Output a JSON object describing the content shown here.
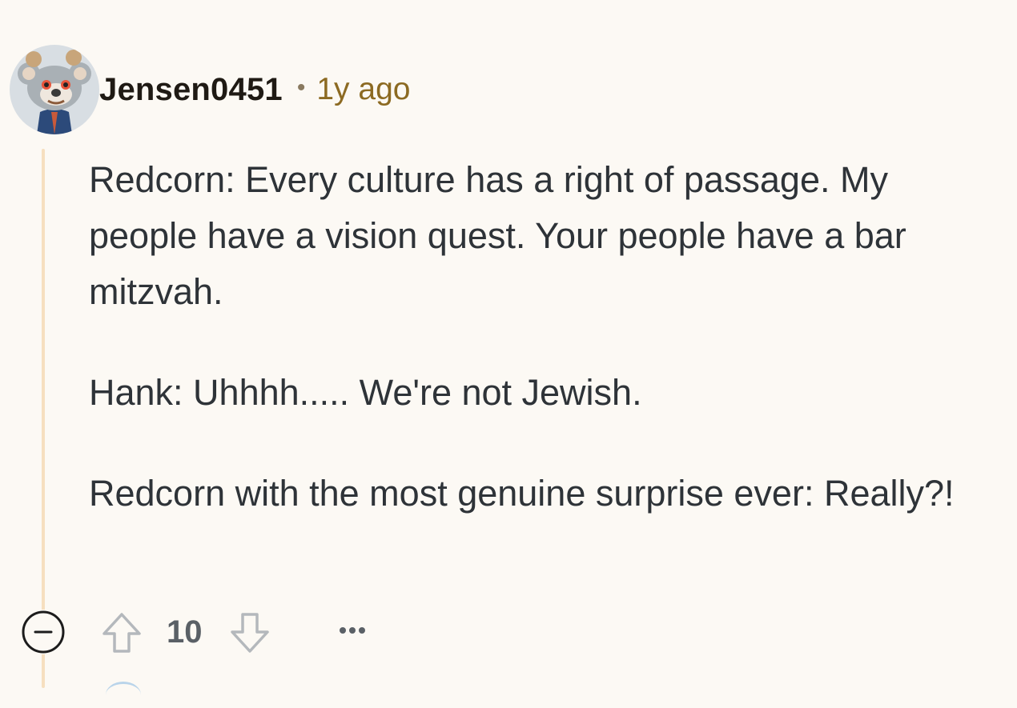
{
  "comment": {
    "author": "Jensen0451",
    "separator": "•",
    "timestamp": "1y ago",
    "paragraphs": [
      "Redcorn: Every culture has a right of passage. My people have a vision quest. Your people have a bar mitzvah.",
      "Hank: Uhhhh..... We're not Jewish.",
      "Redcorn with the most genuine surprise ever: Really?!"
    ],
    "score": "10"
  },
  "icons": {
    "avatar": "snoo-koala-avatar",
    "collapse": "collapse-minus-icon",
    "upvote": "upvote-arrow-icon",
    "downvote": "downvote-arrow-icon",
    "more": "more-options-icon"
  },
  "colors": {
    "background": "#fcf9f4",
    "thread_line": "#f6dfbf",
    "username": "#1f1a14",
    "timestamp": "#8c6a22",
    "body_text": "#2e3338",
    "score": "#5a6066"
  }
}
